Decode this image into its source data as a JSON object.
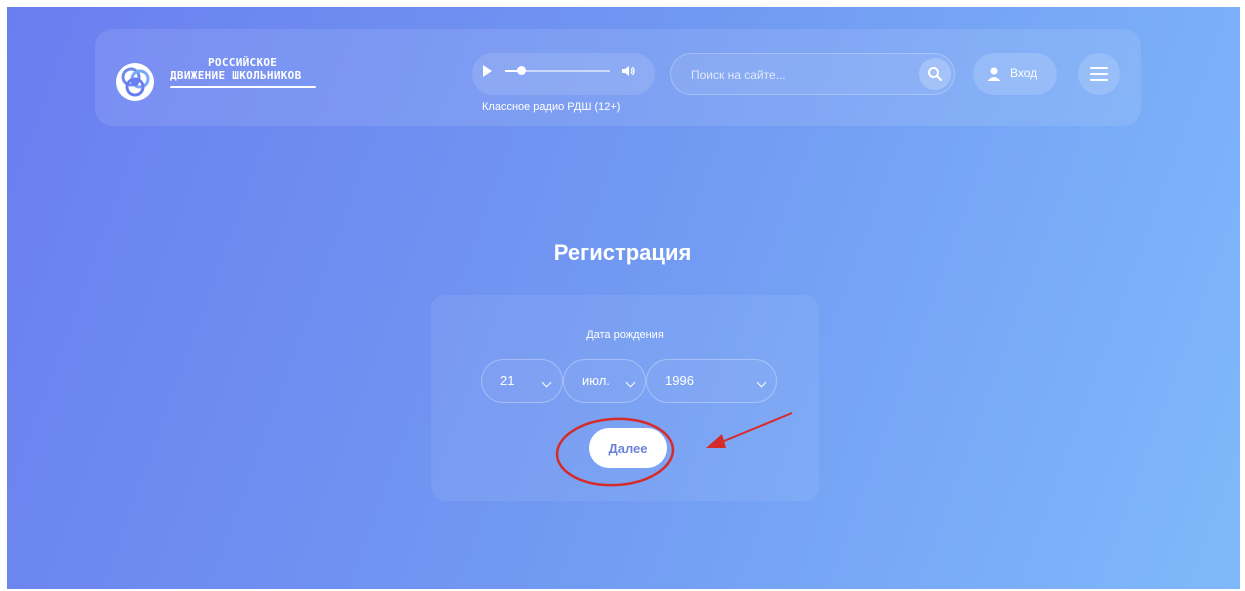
{
  "header": {
    "logo": {
      "line1": "РОССИЙСКОЕ",
      "line2": "ДВИЖЕНИЕ ШКОЛЬНИКОВ"
    },
    "radio": {
      "caption": "Классное радио РДШ (12+)",
      "progress": 0.15
    },
    "search": {
      "placeholder": "Поиск на сайте..."
    },
    "login_label": "Вход"
  },
  "main": {
    "title": "Регистрация",
    "birth_date": {
      "label": "Дата рождения",
      "day": "21",
      "month": "июл.",
      "year": "1996"
    },
    "next_label": "Далее"
  },
  "colors": {
    "background_start": "#6a7ef0",
    "background_end": "#7fb9fb",
    "annotation": "#d62b2b",
    "button_text": "#6c82d6"
  },
  "icons": [
    "logo-emblem-icon",
    "play-icon",
    "volume-icon",
    "search-icon",
    "user-icon",
    "menu-icon",
    "chevron-down-icon"
  ]
}
